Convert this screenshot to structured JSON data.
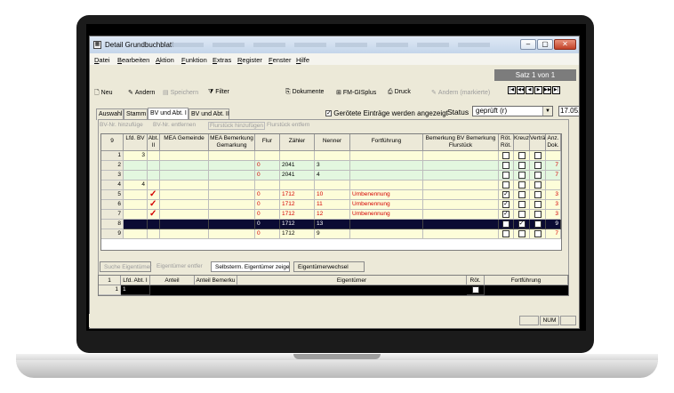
{
  "window": {
    "title": "Detail Grundbuchblatt",
    "app_icon": "grid-icon"
  },
  "menu": [
    "Datei",
    "Bearbeiten",
    "Aktion",
    "Funktion",
    "Extras",
    "Register",
    "Fenster",
    "Hilfe"
  ],
  "record": {
    "label": "Satz 1 von 1"
  },
  "toolbar": {
    "neu": "Neu",
    "andern": "Andern",
    "speichern": "Speichern",
    "filter": "Filter",
    "dokumente": "Dokumente",
    "fm_gisplus": "FM-GISplus",
    "druck": "Druck",
    "andern_markierte": "Andern (markierte)"
  },
  "nav": [
    "|◀",
    "◀◀",
    "◀",
    "▶",
    "▶▶",
    "▶|"
  ],
  "tabs": [
    "Auswahl",
    "Stamm",
    "BV und Abt. I",
    "BV und Abt. II"
  ],
  "gerotet_label": "Gerötete Einträge werden angezeigt",
  "status": {
    "label": "Status",
    "value": "geprüft (r)",
    "date": "17.05."
  },
  "subtoolbar": {
    "bv_add": "BV-Nr. hinzufüge",
    "bv_remove": "BV-Nr. entfernen",
    "flurstueck_add": "Flurstück hinzufügen",
    "flurstueck_remove": "Flurstück entfern"
  },
  "grid": {
    "corner": "9",
    "headers": {
      "lfd": "Lfd. BV",
      "abt": "Abt. II",
      "mea": "MEA Gemeinde",
      "mea_bem": "MEA Bemerkung Gemarkung",
      "flur": "Flur",
      "zaehler": "Zähler",
      "nenner": "Nenner",
      "fortfuehrung": "Fortführung",
      "bem_bv": "Bemerkung BV Bemerkung Flurstück",
      "rot": "Röt. Röt.",
      "kreuz": "Kreuzung",
      "vertraege": "Verträge",
      "anz": "Anz. Dok."
    },
    "rows": [
      {
        "n": "1",
        "lfd": "3",
        "abt": "",
        "flur": "",
        "zaehler": "",
        "nenner": "",
        "fort": "",
        "red": false,
        "check": false,
        "rot": false,
        "kreuz": false,
        "vert": false,
        "anz": ""
      },
      {
        "n": "2",
        "lfd": "",
        "abt": "",
        "flur": "0",
        "zaehler": "2041",
        "nenner": "3",
        "fort": "",
        "red": false,
        "check": false,
        "rot": false,
        "kreuz": false,
        "vert": false,
        "anz": "7"
      },
      {
        "n": "3",
        "lfd": "",
        "abt": "",
        "flur": "0",
        "zaehler": "2041",
        "nenner": "4",
        "fort": "",
        "red": false,
        "check": false,
        "rot": false,
        "kreuz": false,
        "vert": false,
        "anz": "7"
      },
      {
        "n": "4",
        "lfd": "4",
        "abt": "",
        "flur": "",
        "zaehler": "",
        "nenner": "",
        "fort": "",
        "red": false,
        "check": false,
        "rot": false,
        "kreuz": false,
        "vert": false,
        "anz": ""
      },
      {
        "n": "5",
        "lfd": "",
        "abt": "",
        "flur": "0",
        "zaehler": "1712",
        "nenner": "10",
        "fort": "Umbenennung",
        "red": true,
        "check": true,
        "rot": true,
        "kreuz": false,
        "vert": false,
        "anz": "3"
      },
      {
        "n": "6",
        "lfd": "",
        "abt": "",
        "flur": "0",
        "zaehler": "1712",
        "nenner": "11",
        "fort": "Umbenennung",
        "red": true,
        "check": true,
        "rot": true,
        "kreuz": false,
        "vert": false,
        "anz": "3"
      },
      {
        "n": "7",
        "lfd": "",
        "abt": "",
        "flur": "0",
        "zaehler": "1712",
        "nenner": "12",
        "fort": "Umbenennung",
        "red": true,
        "check": true,
        "rot": true,
        "kreuz": false,
        "vert": false,
        "anz": "3"
      },
      {
        "n": "8",
        "lfd": "",
        "abt": "",
        "flur": "0",
        "zaehler": "1712",
        "nenner": "13",
        "fort": "",
        "red": false,
        "check": false,
        "rot": false,
        "kreuz": true,
        "vert": false,
        "anz": "9"
      },
      {
        "n": "9",
        "lfd": "",
        "abt": "",
        "flur": "0",
        "zaehler": "1712",
        "nenner": "9",
        "fort": "",
        "red": false,
        "check": false,
        "rot": false,
        "kreuz": false,
        "vert": false,
        "anz": "7"
      }
    ]
  },
  "owner_toolbar": {
    "suche": "Suche Eigentümer",
    "entfernen": "Eigentümer entfer",
    "selbsterm": "Selbsterm. Eigentümer zeige",
    "wechsel": "Eigentümerwechsel"
  },
  "owner_grid": {
    "corner": "1",
    "headers": {
      "lfd": "Lfd. Abt. I",
      "anteil": "Anteil",
      "anteil_bem": "Anteil Bemerku",
      "eigentuemer": "Eigentümer",
      "rot": "Röt.",
      "fort": "Fortführung"
    },
    "row": {
      "n": "1",
      "lfd": "1"
    }
  },
  "statusbar": {
    "num": "NUM"
  },
  "colors": {
    "green_row": "#e3f7df",
    "yellow_row": "#fdfdd9",
    "selected_row": "#0b0b33",
    "red_text": "#d40000"
  }
}
